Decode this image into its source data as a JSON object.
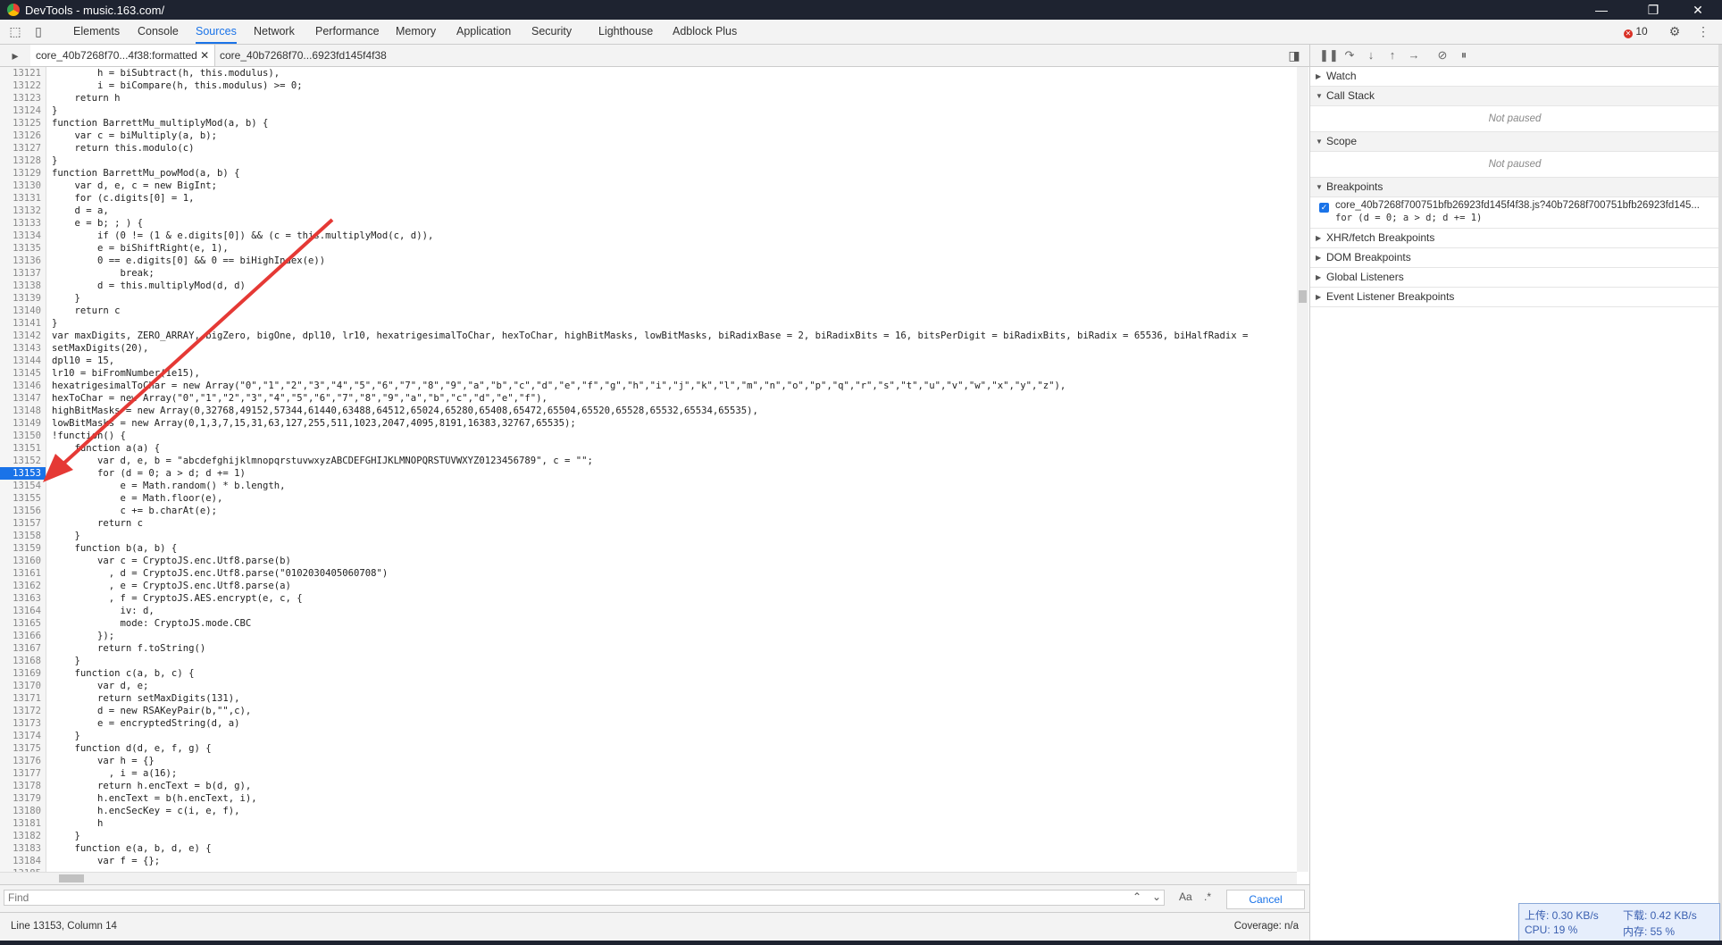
{
  "window": {
    "title": "DevTools - music.163.com/"
  },
  "panel_tabs": [
    "Elements",
    "Console",
    "Sources",
    "Network",
    "Performance",
    "Memory",
    "Application",
    "Security",
    "Lighthouse",
    "Adblock Plus"
  ],
  "active_panel": "Sources",
  "error_count": "10",
  "file_tabs": {
    "active": "core_40b7268f70...4f38:formatted",
    "other": "core_40b7268f70...6923fd145f4f38"
  },
  "editor": {
    "breakpoint_line": "13153",
    "lines": [
      {
        "n": "13121",
        "t": "        h = biSubtract(h, this.modulus),"
      },
      {
        "n": "13122",
        "t": "        i = biCompare(h, this.modulus) >= 0;"
      },
      {
        "n": "13123",
        "t": "    return h"
      },
      {
        "n": "13124",
        "t": "}"
      },
      {
        "n": "13125",
        "t": "function BarrettMu_multiplyMod(a, b) {"
      },
      {
        "n": "13126",
        "t": "    var c = biMultiply(a, b);"
      },
      {
        "n": "13127",
        "t": "    return this.modulo(c)"
      },
      {
        "n": "13128",
        "t": "}"
      },
      {
        "n": "13129",
        "t": "function BarrettMu_powMod(a, b) {"
      },
      {
        "n": "13130",
        "t": "    var d, e, c = new BigInt;"
      },
      {
        "n": "13131",
        "t": "    for (c.digits[0] = 1,"
      },
      {
        "n": "13132",
        "t": "    d = a,"
      },
      {
        "n": "13133",
        "t": "    e = b; ; ) {"
      },
      {
        "n": "13134",
        "t": "        if (0 != (1 & e.digits[0]) && (c = this.multiplyMod(c, d)),"
      },
      {
        "n": "13135",
        "t": "        e = biShiftRight(e, 1),"
      },
      {
        "n": "13136",
        "t": "        0 == e.digits[0] && 0 == biHighIndex(e))"
      },
      {
        "n": "13137",
        "t": "            break;"
      },
      {
        "n": "13138",
        "t": "        d = this.multiplyMod(d, d)"
      },
      {
        "n": "13139",
        "t": "    }"
      },
      {
        "n": "13140",
        "t": "    return c"
      },
      {
        "n": "13141",
        "t": "}"
      },
      {
        "n": "13142",
        "t": "var maxDigits, ZERO_ARRAY, bigZero, bigOne, dpl10, lr10, hexatrigesimalToChar, hexToChar, highBitMasks, lowBitMasks, biRadixBase = 2, biRadixBits = 16, bitsPerDigit = biRadixBits, biRadix = 65536, biHalfRadix ="
      },
      {
        "n": "13143",
        "t": "setMaxDigits(20),"
      },
      {
        "n": "13144",
        "t": "dpl10 = 15,"
      },
      {
        "n": "13145",
        "t": "lr10 = biFromNumber(1e15),"
      },
      {
        "n": "13146",
        "t": "hexatrigesimalToChar = new Array(\"0\",\"1\",\"2\",\"3\",\"4\",\"5\",\"6\",\"7\",\"8\",\"9\",\"a\",\"b\",\"c\",\"d\",\"e\",\"f\",\"g\",\"h\",\"i\",\"j\",\"k\",\"l\",\"m\",\"n\",\"o\",\"p\",\"q\",\"r\",\"s\",\"t\",\"u\",\"v\",\"w\",\"x\",\"y\",\"z\"),"
      },
      {
        "n": "13147",
        "t": "hexToChar = new Array(\"0\",\"1\",\"2\",\"3\",\"4\",\"5\",\"6\",\"7\",\"8\",\"9\",\"a\",\"b\",\"c\",\"d\",\"e\",\"f\"),"
      },
      {
        "n": "13148",
        "t": "highBitMasks = new Array(0,32768,49152,57344,61440,63488,64512,65024,65280,65408,65472,65504,65520,65528,65532,65534,65535),"
      },
      {
        "n": "13149",
        "t": "lowBitMasks = new Array(0,1,3,7,15,31,63,127,255,511,1023,2047,4095,8191,16383,32767,65535);"
      },
      {
        "n": "13150",
        "t": "!function() {"
      },
      {
        "n": "13151",
        "t": "    function a(a) {"
      },
      {
        "n": "13152",
        "t": "        var d, e, b = \"abcdefghijklmnopqrstuvwxyzABCDEFGHIJKLMNOPQRSTUVWXYZ0123456789\", c = \"\";"
      },
      {
        "n": "13153",
        "t": "        for (d = 0; a > d; d += 1)"
      },
      {
        "n": "13154",
        "t": "            e = Math.random() * b.length,"
      },
      {
        "n": "13155",
        "t": "            e = Math.floor(e),"
      },
      {
        "n": "13156",
        "t": "            c += b.charAt(e);"
      },
      {
        "n": "13157",
        "t": "        return c"
      },
      {
        "n": "13158",
        "t": "    }"
      },
      {
        "n": "13159",
        "t": "    function b(a, b) {"
      },
      {
        "n": "13160",
        "t": "        var c = CryptoJS.enc.Utf8.parse(b)"
      },
      {
        "n": "13161",
        "t": "          , d = CryptoJS.enc.Utf8.parse(\"0102030405060708\")"
      },
      {
        "n": "13162",
        "t": "          , e = CryptoJS.enc.Utf8.parse(a)"
      },
      {
        "n": "13163",
        "t": "          , f = CryptoJS.AES.encrypt(e, c, {"
      },
      {
        "n": "13164",
        "t": "            iv: d,"
      },
      {
        "n": "13165",
        "t": "            mode: CryptoJS.mode.CBC"
      },
      {
        "n": "13166",
        "t": "        });"
      },
      {
        "n": "13167",
        "t": "        return f.toString()"
      },
      {
        "n": "13168",
        "t": "    }"
      },
      {
        "n": "13169",
        "t": "    function c(a, b, c) {"
      },
      {
        "n": "13170",
        "t": "        var d, e;"
      },
      {
        "n": "13171",
        "t": "        return setMaxDigits(131),"
      },
      {
        "n": "13172",
        "t": "        d = new RSAKeyPair(b,\"\",c),"
      },
      {
        "n": "13173",
        "t": "        e = encryptedString(d, a)"
      },
      {
        "n": "13174",
        "t": "    }"
      },
      {
        "n": "13175",
        "t": "    function d(d, e, f, g) {"
      },
      {
        "n": "13176",
        "t": "        var h = {}"
      },
      {
        "n": "13177",
        "t": "          , i = a(16);"
      },
      {
        "n": "13178",
        "t": "        return h.encText = b(d, g),"
      },
      {
        "n": "13179",
        "t": "        h.encText = b(h.encText, i),"
      },
      {
        "n": "13180",
        "t": "        h.encSecKey = c(i, e, f),"
      },
      {
        "n": "13181",
        "t": "        h"
      },
      {
        "n": "13182",
        "t": "    }"
      },
      {
        "n": "13183",
        "t": "    function e(a, b, d, e) {"
      },
      {
        "n": "13184",
        "t": "        var f = {};"
      },
      {
        "n": "13185",
        "t": ""
      }
    ]
  },
  "find": {
    "placeholder": "Find",
    "case_label": "Aa",
    "regex_label": ".*",
    "cancel_label": "Cancel"
  },
  "status": {
    "position": "Line 13153, Column 14",
    "coverage": "Coverage: n/a"
  },
  "debugger": {
    "sections": {
      "watch": "Watch",
      "call_stack": "Call Stack",
      "scope": "Scope",
      "breakpoints": "Breakpoints",
      "xhr": "XHR/fetch Breakpoints",
      "dom": "DOM Breakpoints",
      "global": "Global Listeners",
      "event": "Event Listener Breakpoints"
    },
    "not_paused": "Not paused",
    "breakpoint": {
      "file": "core_40b7268f700751bfb26923fd145f4f38.js?40b7268f700751bfb26923fd145...",
      "code": "for (d = 0; a > d; d += 1)"
    }
  },
  "netspeed": {
    "up": "上传: 0.30 KB/s",
    "down": "下载: 0.42 KB/s",
    "cpu": "CPU: 19 %",
    "mem": "内存: 55 %"
  }
}
